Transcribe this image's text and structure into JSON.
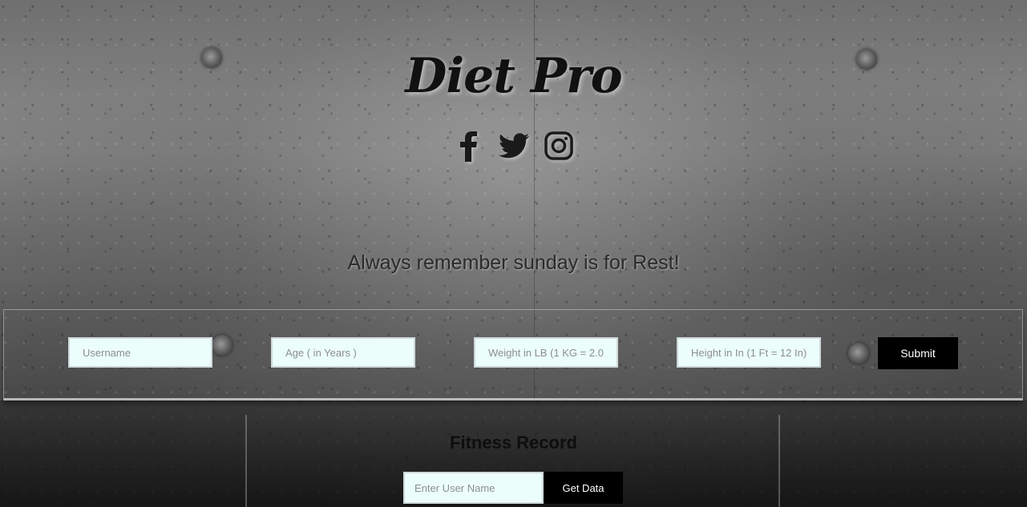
{
  "brand": {
    "title": "Diet Pro"
  },
  "social": [
    {
      "name": "facebook-icon"
    },
    {
      "name": "twitter-icon"
    },
    {
      "name": "instagram-icon"
    }
  ],
  "tagline": "Always remember sunday is for Rest!",
  "form": {
    "username_placeholder": "Username",
    "age_placeholder": "Age ( in Years )",
    "weight_placeholder": "Weight in LB (1 KG = 2.0",
    "height_placeholder": "Height in In (1 Ft = 12 In)",
    "submit_label": "Submit"
  },
  "record": {
    "title": "Fitness Record",
    "user_placeholder": "Enter User Name",
    "get_data_label": "Get Data"
  }
}
